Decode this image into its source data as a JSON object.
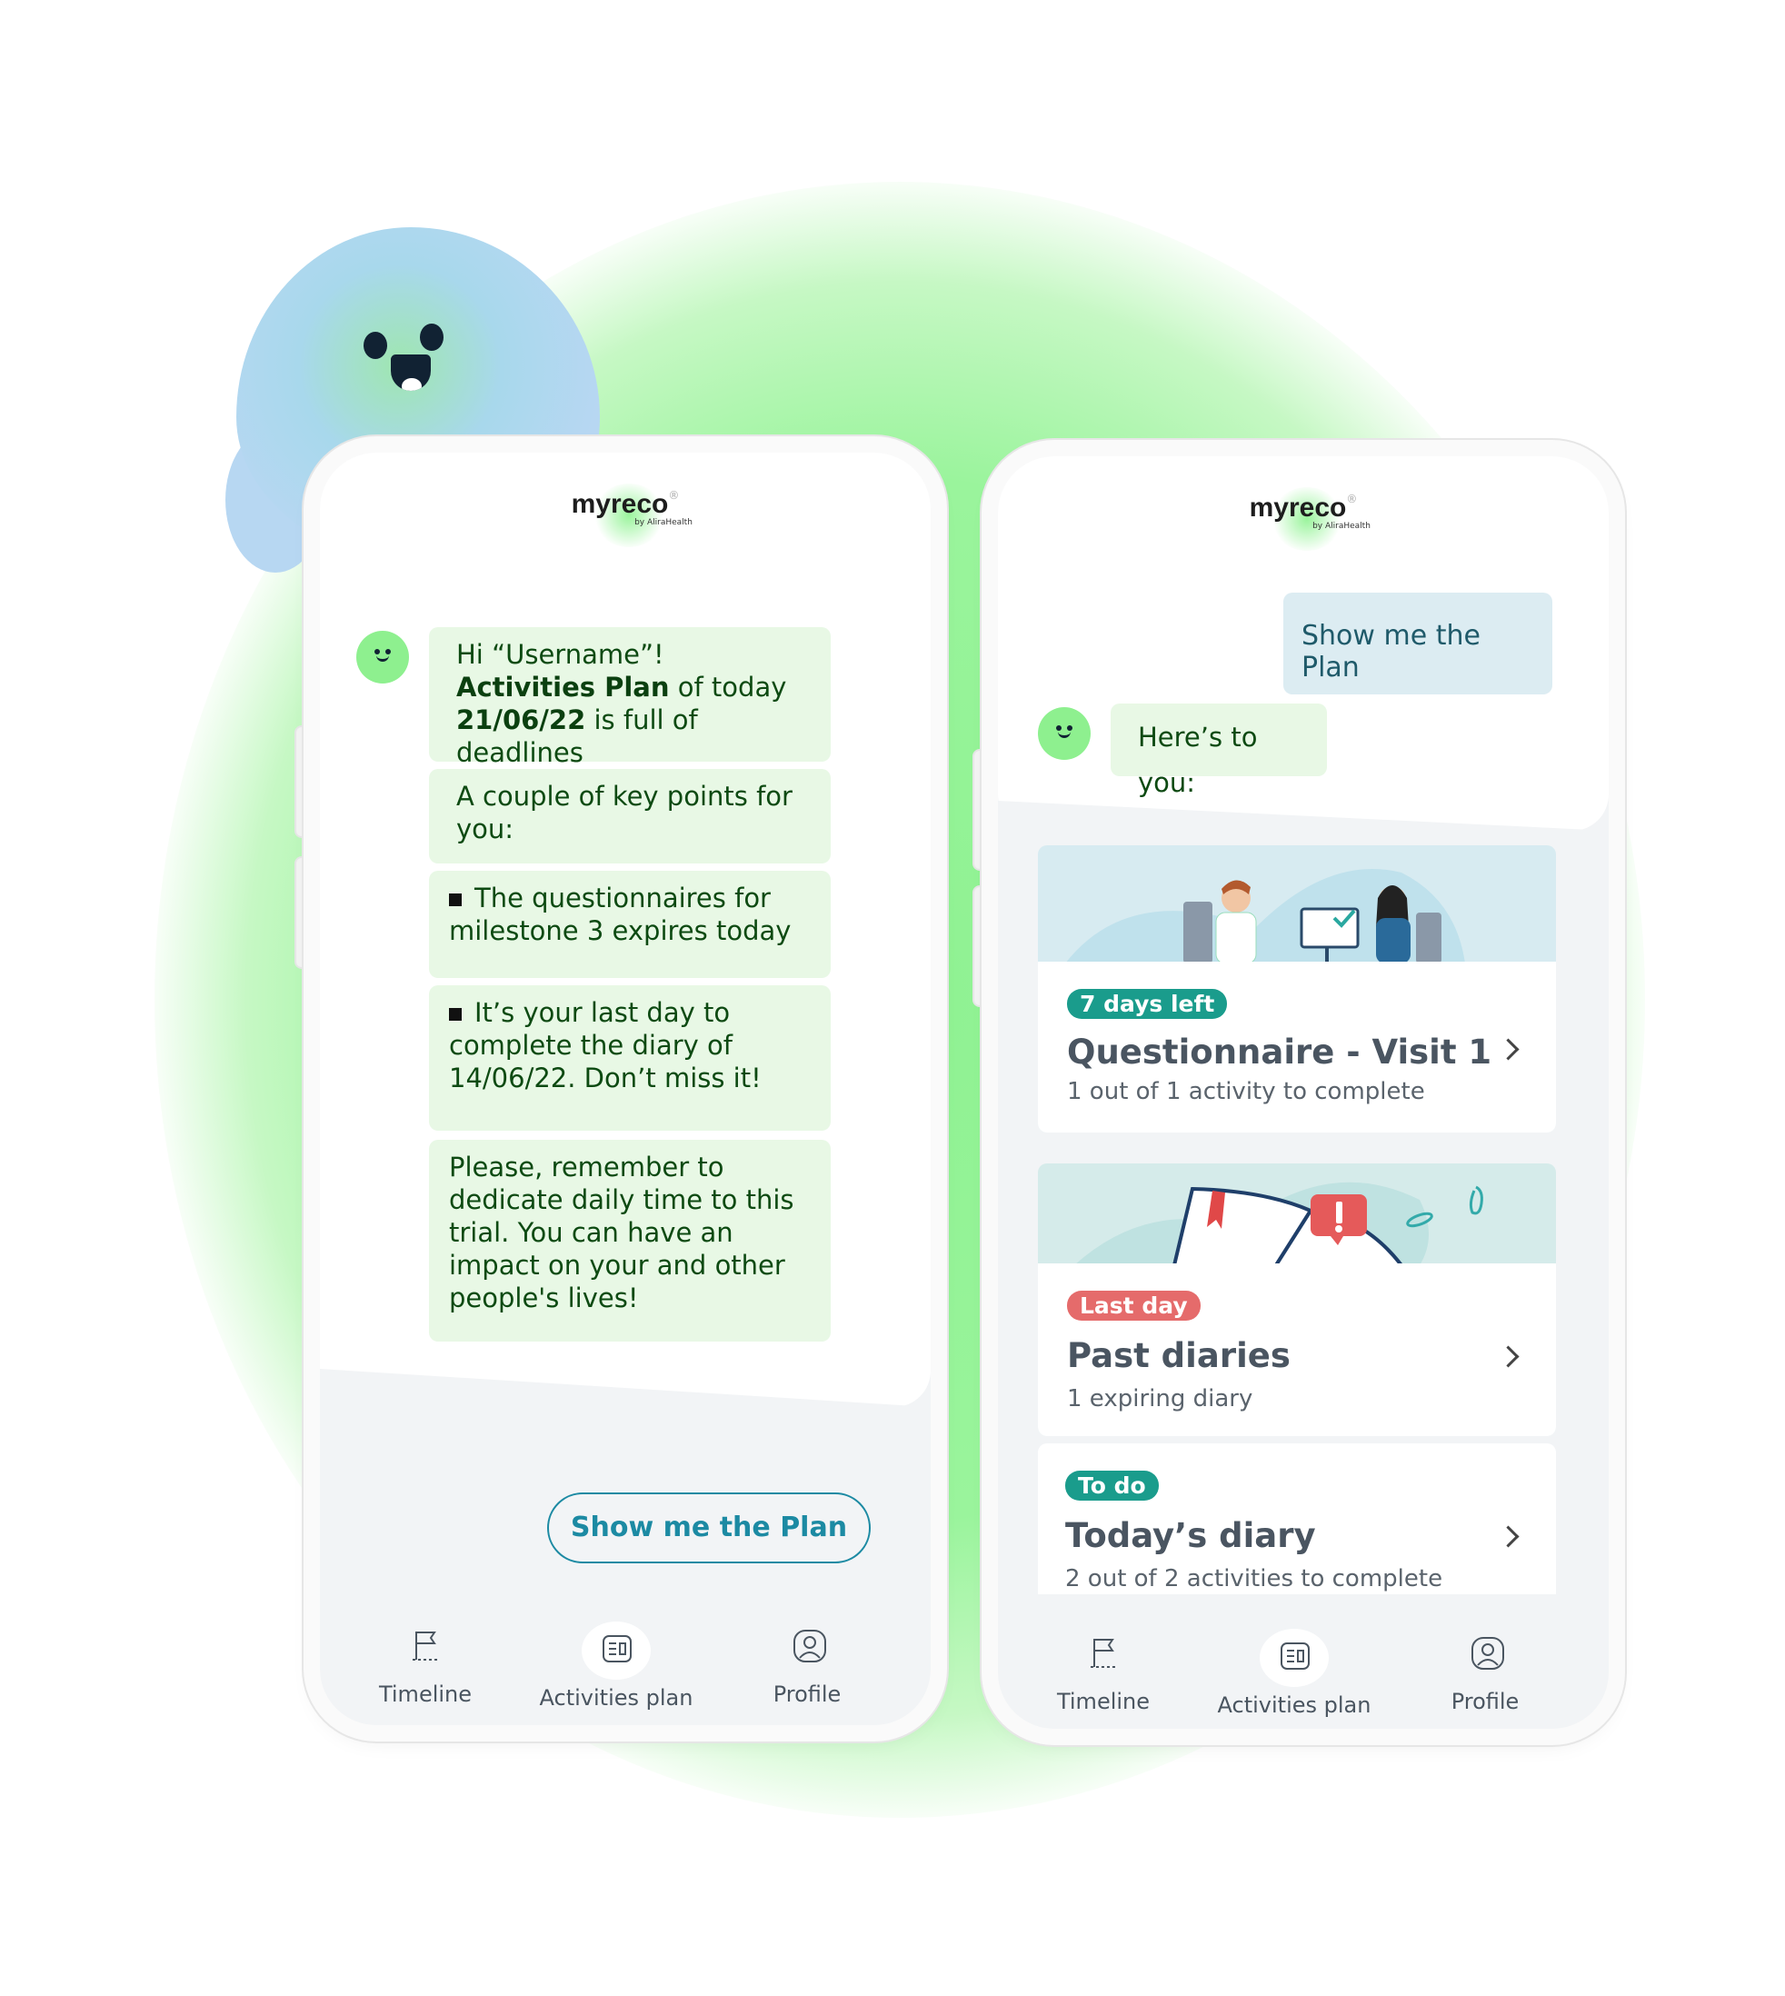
{
  "brand": {
    "name": "myreco",
    "registered": "®",
    "byline": "by AliraHealth"
  },
  "colors": {
    "bot_bubble": "#e8f8e5",
    "accent_teal": "#1c8aa3",
    "badge_green": "#1a9c8c",
    "badge_red": "#e56b6b",
    "glow": "#9af49c"
  },
  "left_phone": {
    "messages": [
      {
        "parts": [
          "Hi “Username”! ",
          "Activities Plan",
          " of today ",
          "21/06/22",
          " is full of deadlines"
        ]
      },
      {
        "text": "A couple of key points for you:"
      },
      {
        "text": "The questionnaires for milestone 3 expires today"
      },
      {
        "text": "It’s your last day to complete the diary of 14/06/22. Don’t miss it!"
      },
      {
        "text": "Please, remember to dedicate daily time to this trial. You can have an impact on your and other people's lives!"
      }
    ],
    "cta_label": "Show me the Plan"
  },
  "right_phone": {
    "user_message": "Show me the Plan",
    "bot_reply": "Here’s to you:",
    "cards": [
      {
        "badge": "7 days left",
        "title": "Questionnaire - Visit 1",
        "subtitle": "1 out of 1 activity to complete"
      },
      {
        "badge": "Last day",
        "title": "Past diaries",
        "subtitle": "1 expiring diary"
      },
      {
        "badge": "To do",
        "title": "Today’s diary",
        "subtitle": "2 out of 2 activities to complete"
      }
    ]
  },
  "nav": {
    "items": [
      {
        "label": "Timeline",
        "icon": "flag-icon"
      },
      {
        "label": "Activities plan",
        "icon": "plan-icon"
      },
      {
        "label": "Profile",
        "icon": "profile-icon"
      }
    ],
    "active": "Activities plan"
  }
}
